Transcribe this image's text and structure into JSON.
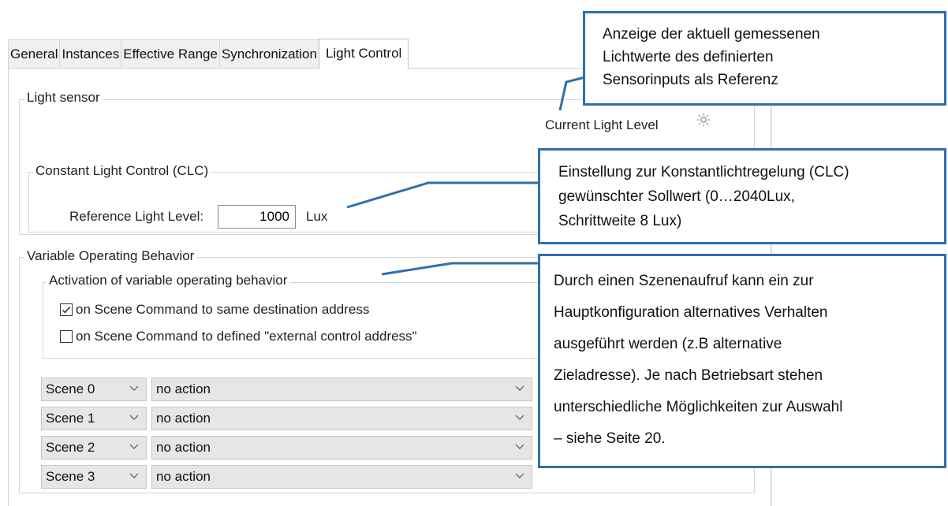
{
  "tabs": [
    {
      "label": "General",
      "active": false
    },
    {
      "label": "Instances",
      "active": false
    },
    {
      "label": "Effective Range",
      "active": false
    },
    {
      "label": "Synchronization",
      "active": false
    },
    {
      "label": "Light Control",
      "active": true
    }
  ],
  "light_sensor": {
    "legend": "Light sensor",
    "current_level_label": "Current Light Level",
    "icon": "sun-icon"
  },
  "clc": {
    "legend": "Constant Light Control (CLC)",
    "reference_label": "Reference Light Level:",
    "reference_value": "1000",
    "unit": "Lux"
  },
  "variable": {
    "legend": "Variable Operating Behavior",
    "activation_legend": "Activation of variable operating behavior",
    "options": [
      {
        "label": "on Scene Command to same destination address",
        "checked": true
      },
      {
        "label": "on Scene Command to defined \"external control address\"",
        "checked": false
      }
    ],
    "scenes": [
      {
        "scene": "Scene 0",
        "action": "no action"
      },
      {
        "scene": "Scene 1",
        "action": "no action"
      },
      {
        "scene": "Scene 2",
        "action": "no action"
      },
      {
        "scene": "Scene 3",
        "action": "no action"
      }
    ]
  },
  "callouts": {
    "light_level": [
      "Anzeige der aktuell gemessenen",
      "Lichtwerte des definierten",
      "Sensorinputs als Referenz"
    ],
    "clc": [
      "Einstellung zur Konstantlichtregelung (CLC)",
      "gewünschter Sollwert (0…2040Lux,",
      "Schrittweite 8 Lux)"
    ],
    "variable": [
      "Durch einen Szenenaufruf kann ein zur",
      "Hauptkonfiguration alternatives  Verhalten",
      "ausgeführt werden (z.B alternative",
      "Zieladresse). Je nach Betriebsart stehen",
      "unterschiedliche Möglichkeiten zur Auswahl",
      "– siehe Seite 20."
    ]
  },
  "colors": {
    "callout_border": "#2f6fae",
    "combo_bg": "#e6e6e6"
  }
}
